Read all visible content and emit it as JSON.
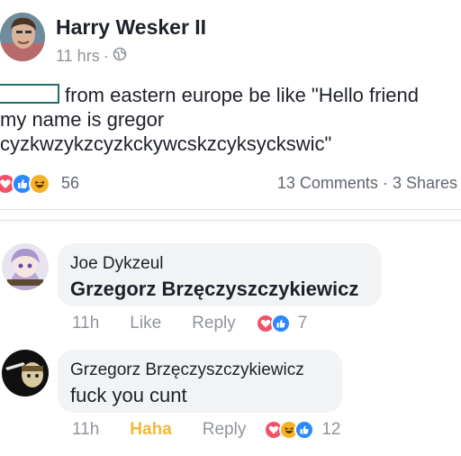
{
  "post": {
    "author": "Harry Wesker II",
    "time": "11 hrs",
    "meta_separator": "·",
    "privacy_icon": "globe-icon",
    "text_lines": [
      "from eastern europe be like \"Hello friend",
      "my name is gregor",
      "cyzkwzykzcyzkckywcskzcyksyckswic\""
    ],
    "reaction_count": "56",
    "comments_label": "13 Comments",
    "shares_label": "3 Shares",
    "share_separator": "·",
    "reaction_icons": [
      "love-icon",
      "like-icon",
      "haha-icon"
    ]
  },
  "comments": [
    {
      "name": "Joe Dykzeul",
      "text": "Grzegorz Brzęczyszczykiewicz",
      "time": "11h",
      "like_label": "Like",
      "reply_label": "Reply",
      "reaction_count": "7",
      "reaction_icons": [
        "love-icon",
        "like-icon"
      ]
    },
    {
      "name": "Grzegorz Brzęczyszczykiewicz",
      "text": "fuck you cunt",
      "time": "11h",
      "like_label": "Haha",
      "reply_label": "Reply",
      "reaction_count": "12",
      "reaction_icons": [
        "love-icon",
        "haha-icon",
        "like-icon"
      ]
    }
  ],
  "colors": {
    "love": "#f25268",
    "like": "#2d88ff",
    "haha": "#f7b125",
    "haha_link": "#f0b938",
    "muted_text": "#90949c",
    "bubble_bg": "#f2f3f5"
  }
}
